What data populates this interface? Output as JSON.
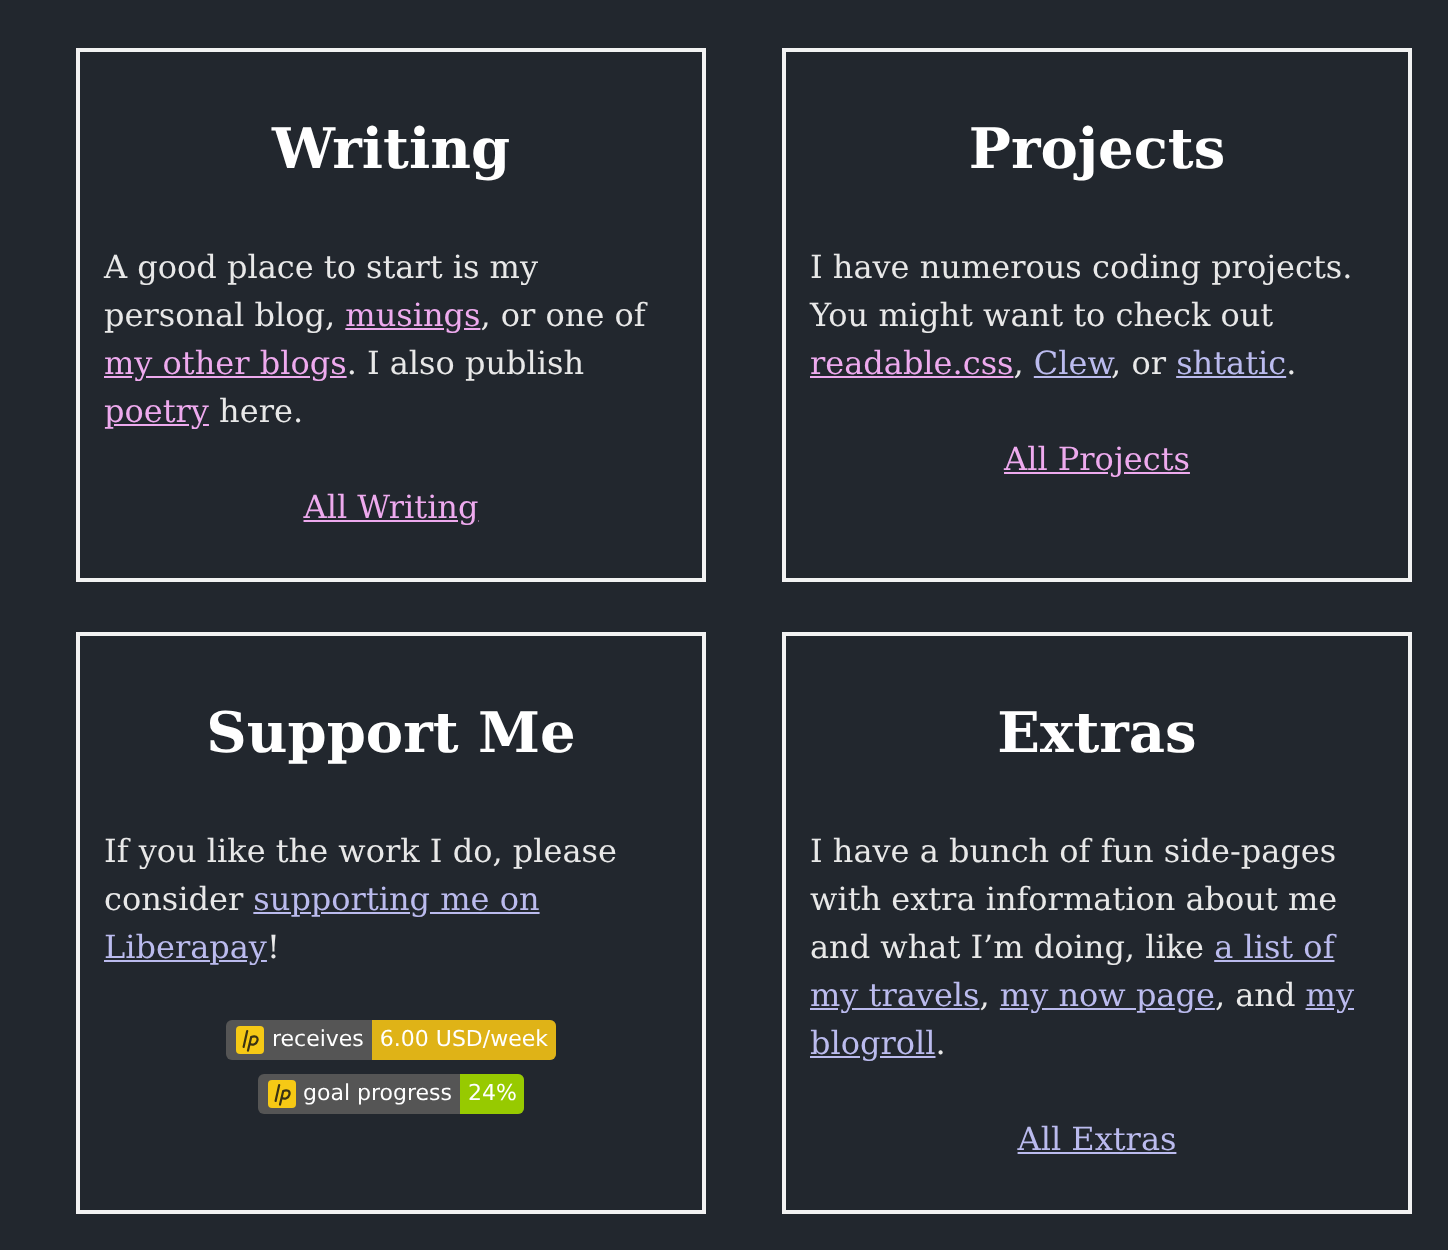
{
  "sections": [
    {
      "title": "Writing",
      "text": [
        {
          "kind": "text",
          "text": "A good place to start is my personal blog, "
        },
        {
          "kind": "link",
          "text": "musings",
          "visited": true
        },
        {
          "kind": "text",
          "text": ", or one of "
        },
        {
          "kind": "link",
          "text": "my other blogs",
          "visited": true
        },
        {
          "kind": "text",
          "text": ". I also publish "
        },
        {
          "kind": "link",
          "text": "poetry",
          "visited": true
        },
        {
          "kind": "text",
          "text": " here."
        }
      ],
      "more_link": {
        "text": "All Writing",
        "visited": true
      }
    },
    {
      "title": "Projects",
      "text": [
        {
          "kind": "text",
          "text": "I have numerous coding projects. You might want to check out "
        },
        {
          "kind": "link",
          "text": "readable.css",
          "visited": true
        },
        {
          "kind": "text",
          "text": ", "
        },
        {
          "kind": "link",
          "text": "Clew",
          "visited": false
        },
        {
          "kind": "text",
          "text": ", or "
        },
        {
          "kind": "link",
          "text": "shtatic",
          "visited": false
        },
        {
          "kind": "text",
          "text": "."
        }
      ],
      "more_link": {
        "text": "All Projects",
        "visited": true
      }
    },
    {
      "title": "Support Me",
      "text": [
        {
          "kind": "text",
          "text": "If you like the work I do, please consider "
        },
        {
          "kind": "link",
          "text": "supporting me on",
          "visited": false
        },
        {
          "kind": "link",
          "text": "Liberapay",
          "visited": false
        },
        {
          "kind": "text",
          "text": "!"
        }
      ],
      "badges": [
        {
          "label": "receives",
          "value": "6.00 USD/week",
          "color": "#dfb317"
        },
        {
          "label": "goal progress",
          "value": "24%",
          "color": "#97ca00"
        }
      ]
    },
    {
      "title": "Extras",
      "text": [
        {
          "kind": "text",
          "text": "I have a bunch of fun side-pages with extra information about me and what I’m doing, like "
        },
        {
          "kind": "link",
          "text": "a list of",
          "visited": false
        },
        {
          "kind": "link",
          "text": "my travels",
          "visited": false
        },
        {
          "kind": "text",
          "text": ", "
        },
        {
          "kind": "link",
          "text": "my now page",
          "visited": false
        },
        {
          "kind": "text",
          "text": ", and "
        },
        {
          "kind": "link",
          "text": "my",
          "visited": false
        },
        {
          "kind": "link",
          "text": "blogroll",
          "visited": false
        },
        {
          "kind": "text",
          "text": "."
        }
      ],
      "more_link": {
        "text": "All Extras",
        "visited": false
      }
    }
  ]
}
